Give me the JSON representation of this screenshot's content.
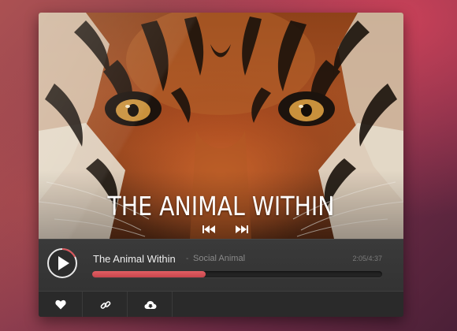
{
  "album": {
    "title": "THE ANIMAL WITHIN"
  },
  "track": {
    "title": "The Animal Within",
    "separator": "-",
    "artist": "Social Animal",
    "time": "2:05/4:37",
    "progress_fraction": 0.39
  },
  "controls": {
    "play_icon": "play-icon",
    "previous_icon": "rewind-icon",
    "next_icon": "fast-forward-icon"
  },
  "actions": [
    {
      "icon": "heart-icon"
    },
    {
      "icon": "link-icon"
    },
    {
      "icon": "cloud-download-icon"
    }
  ],
  "colors": {
    "accent": "#d9545a",
    "panel": "#2f2f2f",
    "text": "#ededed",
    "muted": "#8a8a8a"
  }
}
